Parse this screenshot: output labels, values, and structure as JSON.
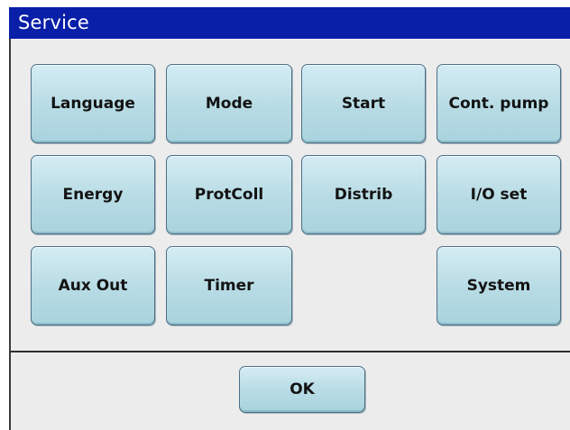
{
  "dialog": {
    "title": "Service"
  },
  "buttons": {
    "language": "Language",
    "mode": "Mode",
    "start": "Start",
    "cont_pump": "Cont. pump",
    "energy": "Energy",
    "protcoll": "ProtColl",
    "distrib": "Distrib",
    "io_set": "I/O set",
    "aux_out": "Aux Out",
    "timer": "Timer",
    "system": "System"
  },
  "footer": {
    "ok": "OK"
  },
  "colors": {
    "titlebar": "#0a1fa8",
    "dialog_bg": "#ececec",
    "button_fill": "#b7dbe4",
    "button_border": "#4f6f86"
  }
}
